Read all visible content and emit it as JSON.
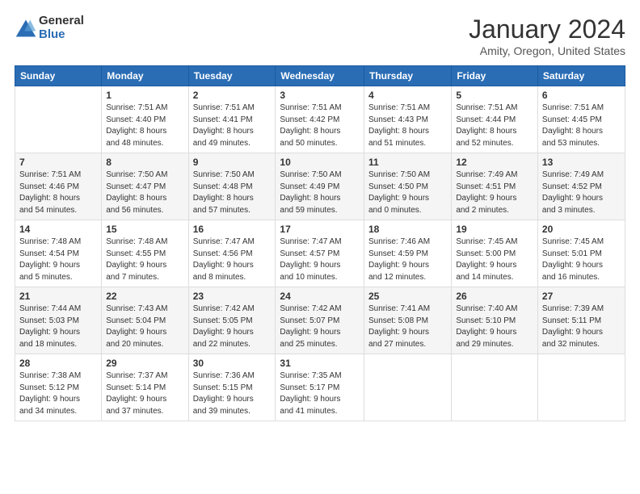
{
  "logo": {
    "general": "General",
    "blue": "Blue"
  },
  "title": "January 2024",
  "location": "Amity, Oregon, United States",
  "days_of_week": [
    "Sunday",
    "Monday",
    "Tuesday",
    "Wednesday",
    "Thursday",
    "Friday",
    "Saturday"
  ],
  "weeks": [
    [
      {
        "num": "",
        "info": ""
      },
      {
        "num": "1",
        "info": "Sunrise: 7:51 AM\nSunset: 4:40 PM\nDaylight: 8 hours\nand 48 minutes."
      },
      {
        "num": "2",
        "info": "Sunrise: 7:51 AM\nSunset: 4:41 PM\nDaylight: 8 hours\nand 49 minutes."
      },
      {
        "num": "3",
        "info": "Sunrise: 7:51 AM\nSunset: 4:42 PM\nDaylight: 8 hours\nand 50 minutes."
      },
      {
        "num": "4",
        "info": "Sunrise: 7:51 AM\nSunset: 4:43 PM\nDaylight: 8 hours\nand 51 minutes."
      },
      {
        "num": "5",
        "info": "Sunrise: 7:51 AM\nSunset: 4:44 PM\nDaylight: 8 hours\nand 52 minutes."
      },
      {
        "num": "6",
        "info": "Sunrise: 7:51 AM\nSunset: 4:45 PM\nDaylight: 8 hours\nand 53 minutes."
      }
    ],
    [
      {
        "num": "7",
        "info": "Sunrise: 7:51 AM\nSunset: 4:46 PM\nDaylight: 8 hours\nand 54 minutes."
      },
      {
        "num": "8",
        "info": "Sunrise: 7:50 AM\nSunset: 4:47 PM\nDaylight: 8 hours\nand 56 minutes."
      },
      {
        "num": "9",
        "info": "Sunrise: 7:50 AM\nSunset: 4:48 PM\nDaylight: 8 hours\nand 57 minutes."
      },
      {
        "num": "10",
        "info": "Sunrise: 7:50 AM\nSunset: 4:49 PM\nDaylight: 8 hours\nand 59 minutes."
      },
      {
        "num": "11",
        "info": "Sunrise: 7:50 AM\nSunset: 4:50 PM\nDaylight: 9 hours\nand 0 minutes."
      },
      {
        "num": "12",
        "info": "Sunrise: 7:49 AM\nSunset: 4:51 PM\nDaylight: 9 hours\nand 2 minutes."
      },
      {
        "num": "13",
        "info": "Sunrise: 7:49 AM\nSunset: 4:52 PM\nDaylight: 9 hours\nand 3 minutes."
      }
    ],
    [
      {
        "num": "14",
        "info": "Sunrise: 7:48 AM\nSunset: 4:54 PM\nDaylight: 9 hours\nand 5 minutes."
      },
      {
        "num": "15",
        "info": "Sunrise: 7:48 AM\nSunset: 4:55 PM\nDaylight: 9 hours\nand 7 minutes."
      },
      {
        "num": "16",
        "info": "Sunrise: 7:47 AM\nSunset: 4:56 PM\nDaylight: 9 hours\nand 8 minutes."
      },
      {
        "num": "17",
        "info": "Sunrise: 7:47 AM\nSunset: 4:57 PM\nDaylight: 9 hours\nand 10 minutes."
      },
      {
        "num": "18",
        "info": "Sunrise: 7:46 AM\nSunset: 4:59 PM\nDaylight: 9 hours\nand 12 minutes."
      },
      {
        "num": "19",
        "info": "Sunrise: 7:45 AM\nSunset: 5:00 PM\nDaylight: 9 hours\nand 14 minutes."
      },
      {
        "num": "20",
        "info": "Sunrise: 7:45 AM\nSunset: 5:01 PM\nDaylight: 9 hours\nand 16 minutes."
      }
    ],
    [
      {
        "num": "21",
        "info": "Sunrise: 7:44 AM\nSunset: 5:03 PM\nDaylight: 9 hours\nand 18 minutes."
      },
      {
        "num": "22",
        "info": "Sunrise: 7:43 AM\nSunset: 5:04 PM\nDaylight: 9 hours\nand 20 minutes."
      },
      {
        "num": "23",
        "info": "Sunrise: 7:42 AM\nSunset: 5:05 PM\nDaylight: 9 hours\nand 22 minutes."
      },
      {
        "num": "24",
        "info": "Sunrise: 7:42 AM\nSunset: 5:07 PM\nDaylight: 9 hours\nand 25 minutes."
      },
      {
        "num": "25",
        "info": "Sunrise: 7:41 AM\nSunset: 5:08 PM\nDaylight: 9 hours\nand 27 minutes."
      },
      {
        "num": "26",
        "info": "Sunrise: 7:40 AM\nSunset: 5:10 PM\nDaylight: 9 hours\nand 29 minutes."
      },
      {
        "num": "27",
        "info": "Sunrise: 7:39 AM\nSunset: 5:11 PM\nDaylight: 9 hours\nand 32 minutes."
      }
    ],
    [
      {
        "num": "28",
        "info": "Sunrise: 7:38 AM\nSunset: 5:12 PM\nDaylight: 9 hours\nand 34 minutes."
      },
      {
        "num": "29",
        "info": "Sunrise: 7:37 AM\nSunset: 5:14 PM\nDaylight: 9 hours\nand 37 minutes."
      },
      {
        "num": "30",
        "info": "Sunrise: 7:36 AM\nSunset: 5:15 PM\nDaylight: 9 hours\nand 39 minutes."
      },
      {
        "num": "31",
        "info": "Sunrise: 7:35 AM\nSunset: 5:17 PM\nDaylight: 9 hours\nand 41 minutes."
      },
      {
        "num": "",
        "info": ""
      },
      {
        "num": "",
        "info": ""
      },
      {
        "num": "",
        "info": ""
      }
    ]
  ]
}
